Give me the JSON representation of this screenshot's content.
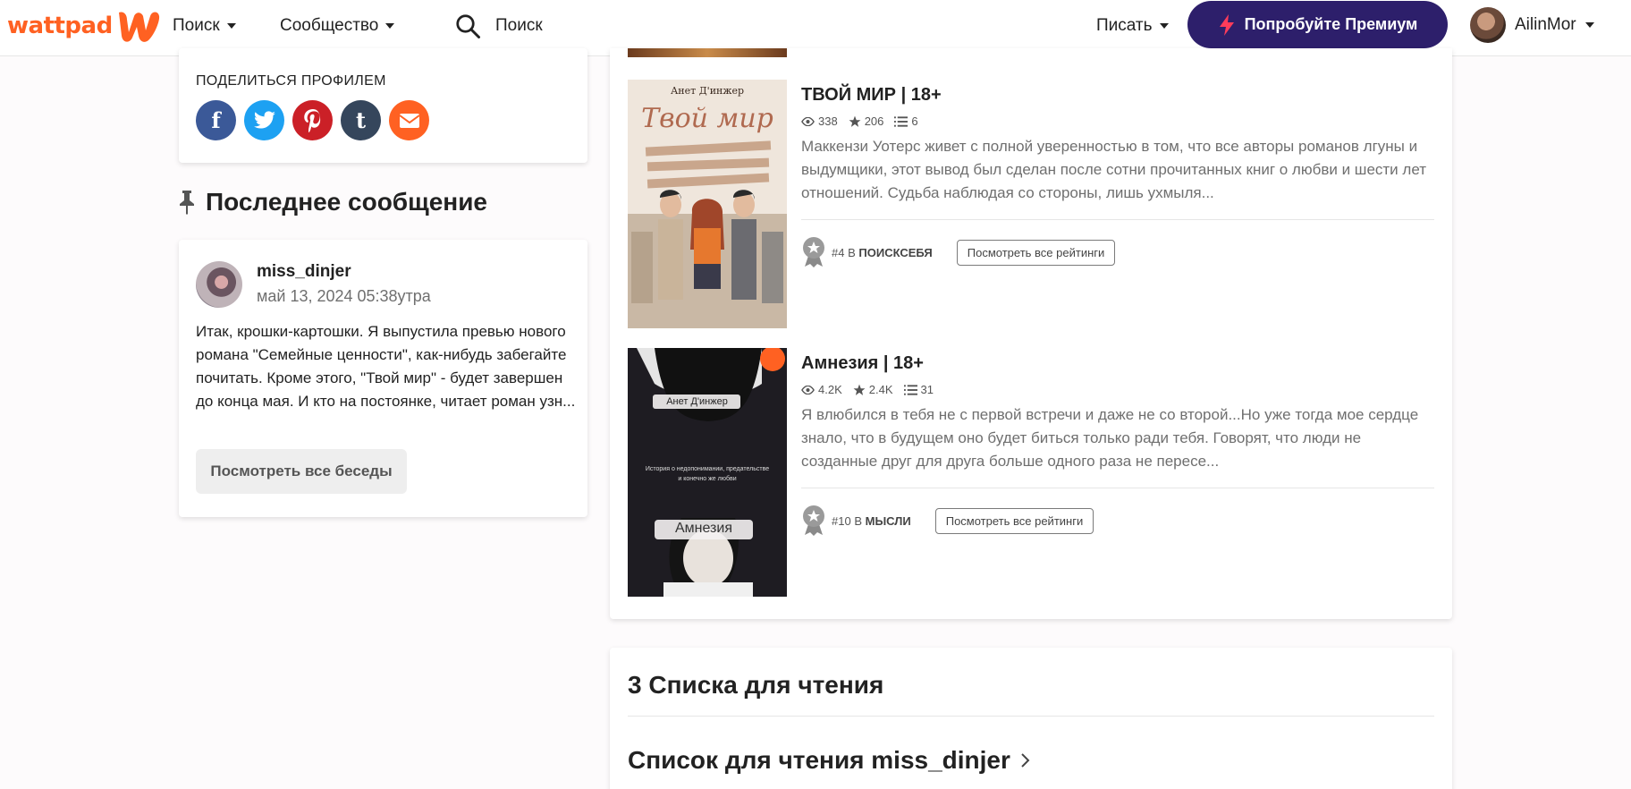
{
  "header": {
    "logo_text": "wattpad",
    "nav": [
      {
        "label": "Поиск"
      },
      {
        "label": "Сообщество"
      }
    ],
    "search": {
      "placeholder": "Поиск"
    },
    "write_label": "Писать",
    "premium_label": "Попробуйте Премиум",
    "username": "AilinMor",
    "brand_color": "#ff6122",
    "premium_color": "#2d1f6b"
  },
  "share": {
    "label": "ПОДЕЛИТЬСЯ ПРОФИЛЕМ",
    "icons": [
      "facebook-icon",
      "twitter-icon",
      "pinterest-icon",
      "tumblr-icon",
      "email-icon"
    ]
  },
  "last_message": {
    "title": "Последнее сообщение",
    "user": "miss_dinjer",
    "date": "май 13, 2024 05:38утра",
    "text": "Итак, крошки-картошки. Я выпустила превью нового романа \"Семейные ценности\", как-нибудь забегайте почитать. Кроме этого, \"Твой мир\" - будет завершен до конца мая. И кто на постоянке, читает роман узн...",
    "button_label": "Посмотреть все беседы"
  },
  "stories": [
    {
      "title": "ТВОЙ МИР | 18+",
      "reads": "338",
      "votes": "206",
      "parts": "6",
      "description": "Маккензи Уотерс живет с полной уверенностью в том, что все авторы романов лгуны и выдумщики, этот вывод был сделан после сотни прочитанных книг о любви и шести лет отношений. Судьба наблюдая со стороны, лишь ухмыля...",
      "rank_number": "#4",
      "rank_in": "В",
      "rank_tag": "ПОИСКСЕБЯ",
      "rank_button": "Посмотреть все рейтинги",
      "cover_author": "Анет Д'инжер",
      "cover_title": "Твой мир"
    },
    {
      "title": "Амнезия | 18+",
      "reads": "4.2K",
      "votes": "2.4K",
      "parts": "31",
      "description": "Я влюбился в тебя не с первой встречи и даже не со второй...Но уже тогда мое сердце знало, что в будущем оно будет биться только ради тебя. Говорят, что люди не созданные друг для друга больше одного раза не пересе...",
      "rank_number": "#10",
      "rank_in": "В",
      "rank_tag": "МЫСЛИ",
      "rank_button": "Посмотреть все рейтинги",
      "cover_author": "Анет Д'инжер",
      "cover_title": "Амнезия",
      "cover_tagline": "История о недопонимании, предательстве и конечно же любви"
    }
  ],
  "reading_lists": {
    "title": "3 Списка для чтения",
    "first_list": "Список для чтения miss_dinjer"
  }
}
